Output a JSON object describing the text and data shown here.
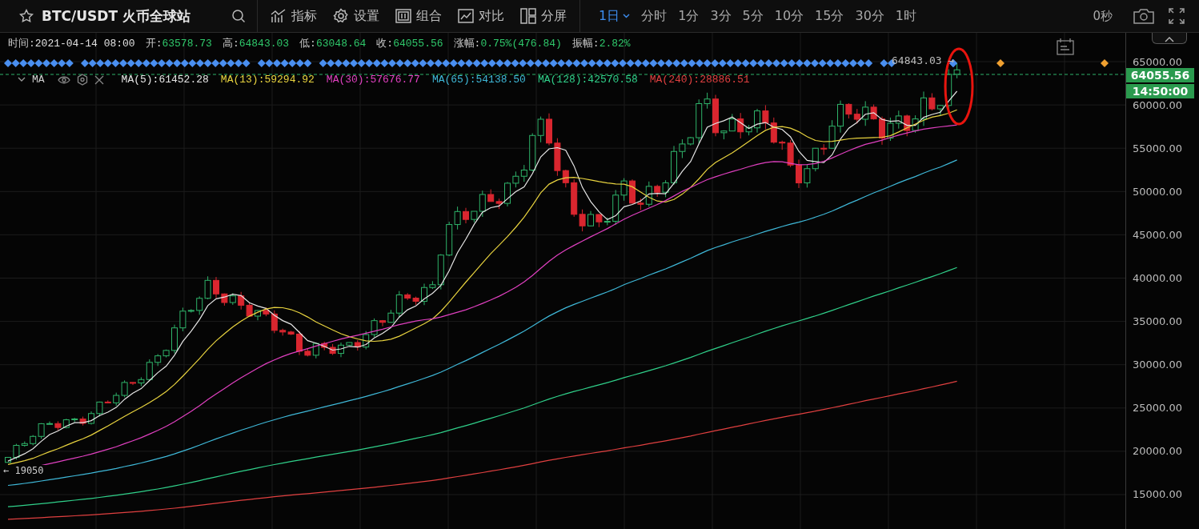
{
  "toolbar": {
    "symbol": "BTC/USDT 火币全球站",
    "tools": [
      {
        "label": "指标"
      },
      {
        "label": "设置"
      },
      {
        "label": "组合"
      },
      {
        "label": "对比"
      },
      {
        "label": "分屏"
      }
    ],
    "intervals": [
      {
        "label": "1日",
        "selected": true,
        "dropdown": true
      },
      {
        "label": "分时",
        "selected": false,
        "dropdown": false
      },
      {
        "label": "1分",
        "selected": false,
        "dropdown": false
      },
      {
        "label": "3分",
        "selected": false,
        "dropdown": false
      },
      {
        "label": "5分",
        "selected": false,
        "dropdown": false
      },
      {
        "label": "10分",
        "selected": false,
        "dropdown": false
      },
      {
        "label": "15分",
        "selected": false,
        "dropdown": false
      },
      {
        "label": "30分",
        "selected": false,
        "dropdown": false
      },
      {
        "label": "1时",
        "selected": false,
        "dropdown": false
      }
    ],
    "refresh": "0秒"
  },
  "info_bar": [
    {
      "label": "时间:",
      "value": "2021-04-14 08:00",
      "kind": "plain"
    },
    {
      "label": "开:",
      "value": "63578.73",
      "kind": "up"
    },
    {
      "label": "高:",
      "value": "64843.03",
      "kind": "up"
    },
    {
      "label": "低:",
      "value": "63048.64",
      "kind": "up"
    },
    {
      "label": "收:",
      "value": "64055.56",
      "kind": "up"
    },
    {
      "label": "涨幅:",
      "value": "0.75%(476.84)",
      "kind": "up"
    },
    {
      "label": "振幅:",
      "value": "2.82%",
      "kind": "up"
    }
  ],
  "indicator": {
    "name": "MA",
    "values": [
      {
        "text": "MA(5):61452.28",
        "color": "#e6e6e6"
      },
      {
        "text": "MA(13):59294.92",
        "color": "#e8d33f"
      },
      {
        "text": "MA(30):57676.77",
        "color": "#e040c0"
      },
      {
        "text": "MA(65):54138.50",
        "color": "#3fb8d8"
      },
      {
        "text": "MA(128):42570.58",
        "color": "#30d08a"
      },
      {
        "text": "MA(240):28886.51",
        "color": "#e04040"
      }
    ]
  },
  "chart": {
    "high_label": "64843.03 →",
    "low_label": "← 19050",
    "last_price": "64055.56",
    "countdown": "14:50:00",
    "y_axis": [
      "65000.00",
      "60000.00",
      "55000.00",
      "50000.00",
      "45000.00",
      "40000.00",
      "35000.00",
      "30000.00",
      "25000.00",
      "20000.00",
      "15000.00"
    ]
  }
}
